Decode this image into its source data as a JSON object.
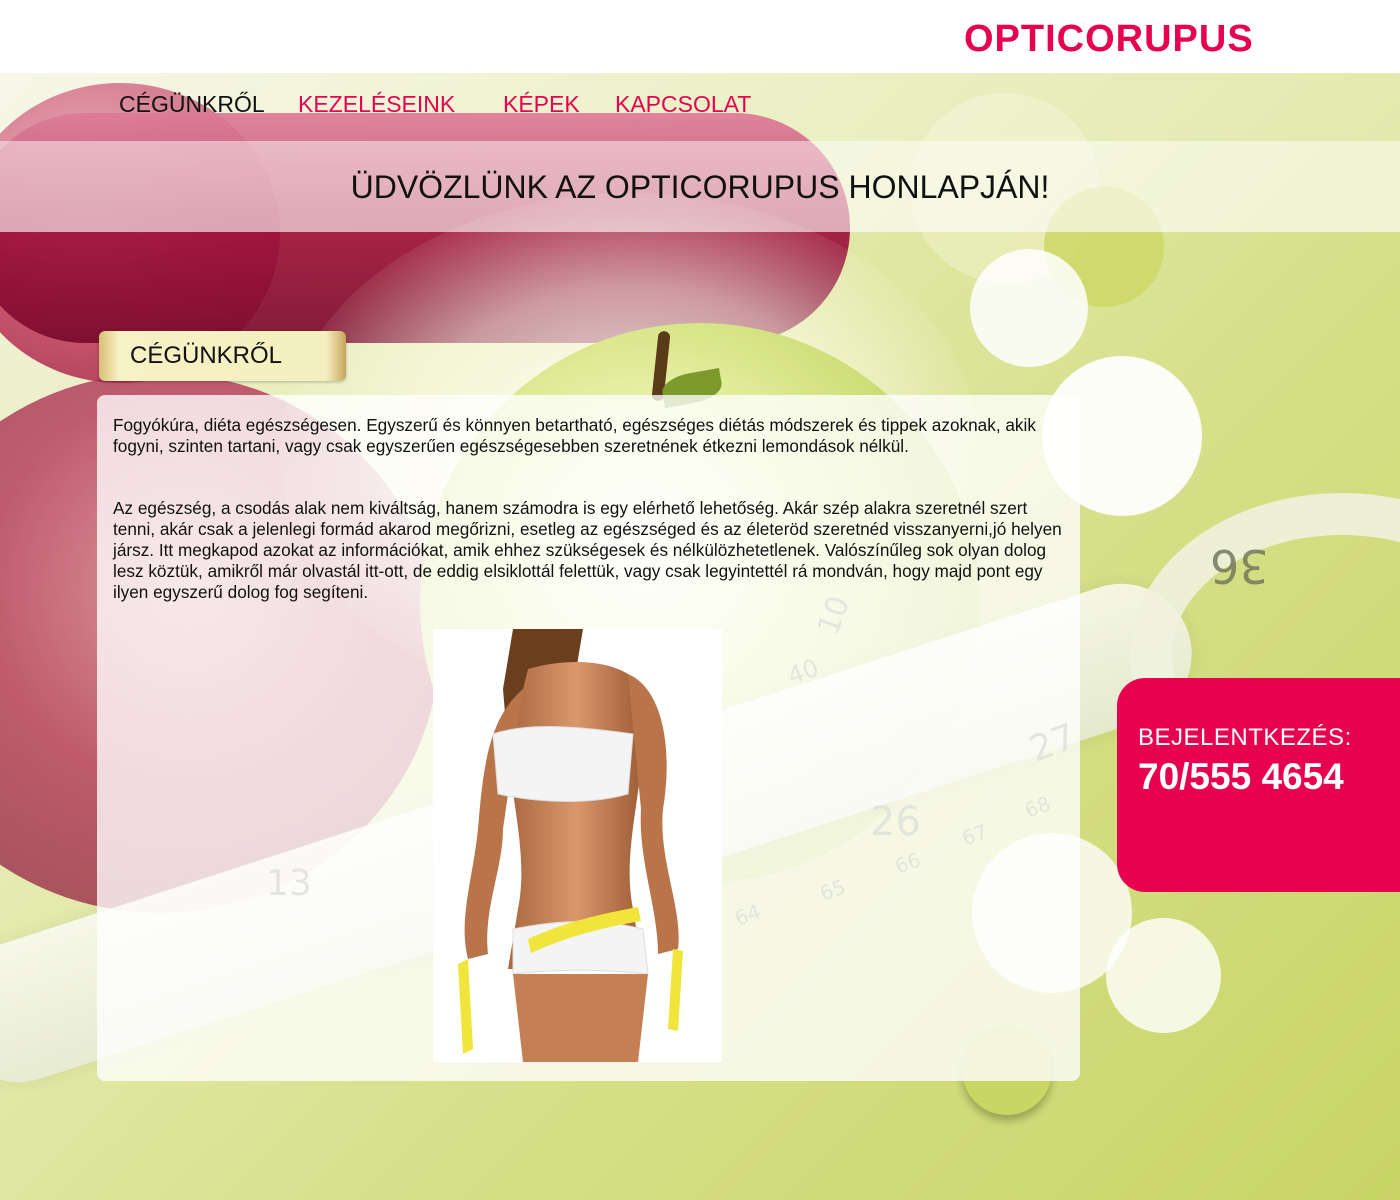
{
  "brand": {
    "name": "OPTICORUPUS"
  },
  "nav": {
    "items": [
      {
        "label": "CÉGÜNKRŐL",
        "active": true
      },
      {
        "label": "KEZELÉSEINK",
        "active": false
      },
      {
        "label": "KÉPEK",
        "active": false
      },
      {
        "label": "KAPCSOLAT",
        "active": false
      }
    ]
  },
  "welcome": {
    "title": "ÜDVÖZLÜNK AZ OPTICORUPUS HONLAPJÁN!"
  },
  "section": {
    "title": "CÉGÜNKRŐL"
  },
  "content": {
    "paragraphs": [
      "Fogyókúra, diéta egészségesen. Egyszerű és könnyen betartható, egészséges diétás módszerek és tippek azoknak, akik fogyni, szinten tartani, vagy csak egyszerűen egészségesebben szeretnének étkezni lemondások nélkül.",
      "Az egészség, a csodás alak nem kiváltság, hanem számodra is egy elérhető lehetőség. Akár szép alakra szeretnél szert tenni, akár csak a jelenlegi formád akarod megőrizni, esetleg az egészséged és az életeröd szeretnéd visszanyerni,jó helyen jársz. Itt megkapod azokat az információkat, amik ehhez szükségesek és nélkülözhetetlenek. Valószínűleg sok olyan dolog lesz köztük, amikről már olvastál itt-ott, de eddig elsiklottál felettük, vagy csak legyintettél rá mondván, hogy majd pont egy ilyen egyszerű dolog fog segíteni."
    ]
  },
  "background": {
    "tape_numbers": [
      "36",
      "13",
      "26",
      "27",
      "40",
      "10",
      "64",
      "65",
      "66",
      "67",
      "68"
    ]
  },
  "contact": {
    "label": "BEJELENTKEZÉS:",
    "phone": "70/555 4654"
  },
  "colors": {
    "accent": "#e6024f",
    "lime": "#c9d76a",
    "text": "#111111"
  }
}
